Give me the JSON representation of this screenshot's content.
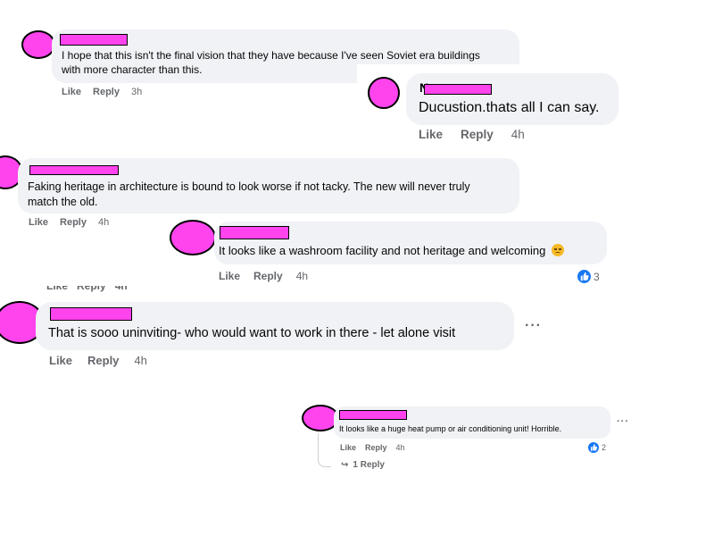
{
  "labels": {
    "like": "Like",
    "reply": "Reply"
  },
  "comments": [
    {
      "text_lines": [
        "I hope that this isn't the final vision that they have because I've seen Soviet era buildings",
        "with more character than this."
      ],
      "time": "3h"
    },
    {
      "name_visible": "N",
      "text_lines": [
        "Ducustion.thats all I can say."
      ],
      "time": "4h"
    },
    {
      "text_lines": [
        "Faking heritage in architecture is bound to look worse if not tacky. The new will never truly",
        "match the old."
      ],
      "time": "4h"
    },
    {
      "text_lines": [
        "It looks like a washroom facility and not heritage and welcoming"
      ],
      "emoji": "😞",
      "time": "4h",
      "reactions": "3"
    },
    {
      "text_lines": [
        "That is sooo uninviting- who would want to work in there - let alone visit"
      ],
      "time": "4h",
      "more": "···"
    },
    {
      "text_lines": [
        "It looks like a huge heat pump or air conditioning unit! Horrible."
      ],
      "time": "4h",
      "reactions": "2",
      "more": "···",
      "replies_link": "1 Reply"
    }
  ],
  "colors": {
    "avatar": "#ff44ee",
    "bubble": "#f0f2f5",
    "meta": "#65676b",
    "like_badge": "#1877f2"
  }
}
